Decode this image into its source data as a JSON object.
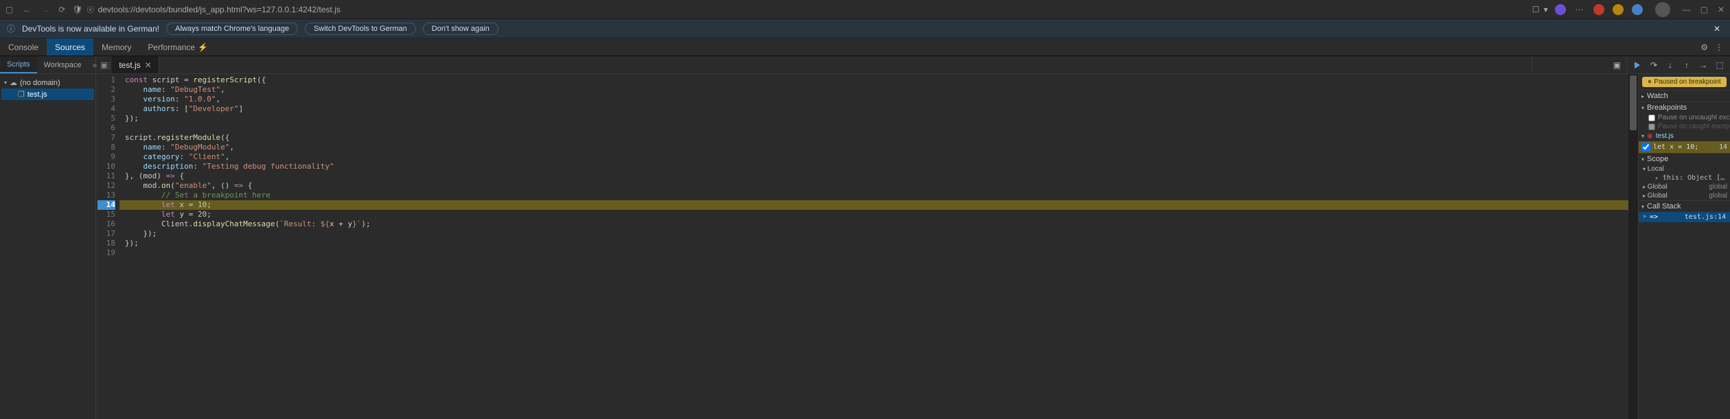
{
  "browser": {
    "url": "devtools://devtools/bundled/js_app.html?ws=127.0.0.1:4242/test.js"
  },
  "infobar": {
    "message": "DevTools is now available in German!",
    "btn1": "Always match Chrome's language",
    "btn2": "Switch DevTools to German",
    "btn3": "Don't show again"
  },
  "tabs": {
    "console": "Console",
    "sources": "Sources",
    "memory": "Memory",
    "performance": "Performance"
  },
  "subtabs": {
    "scripts": "Scripts",
    "workspace": "Workspace"
  },
  "filetab": {
    "name": "test.js"
  },
  "tree": {
    "domain": "(no domain)",
    "file": "test.js"
  },
  "code": {
    "l1": "const script = registerScript({",
    "l2": "    name: \"DebugTest\",",
    "l3": "    version: \"1.0.0\",",
    "l4": "    authors: [\"Developer\"]",
    "l5": "});",
    "l6": "",
    "l7": "script.registerModule({",
    "l8": "    name: \"DebugModule\",",
    "l9": "    category: \"Client\",",
    "l10": "    description: \"Testing debug functionality\"",
    "l11": "}, (mod) => {",
    "l12": "    mod.on(\"enable\", () => {",
    "l13": "        // Set a breakpoint here",
    "l14": "        let x = 10;",
    "l15": "        let y = 20;",
    "l16": "        Client.displayChatMessage(`Result: ${x + y}`);",
    "l17": "    });",
    "l18": "});",
    "l19": ""
  },
  "debug": {
    "paused": "Paused on breakpoint",
    "watch": "Watch",
    "breakpoints": "Breakpoints",
    "pauseUncaught": "Pause on uncaught exceptions",
    "pauseCaught": "Pause on caught exceptions",
    "bpFile": "test.js",
    "bpCode": "let x = 10;",
    "bpLine": "14",
    "scope": "Scope",
    "local": "Local",
    "this": "this: Object [object global]",
    "global1": "Global",
    "global1v": "global",
    "global2": "Global",
    "global2v": "global",
    "callstack": "Call Stack",
    "frame": "=>",
    "frameLoc": "test.js:14"
  }
}
